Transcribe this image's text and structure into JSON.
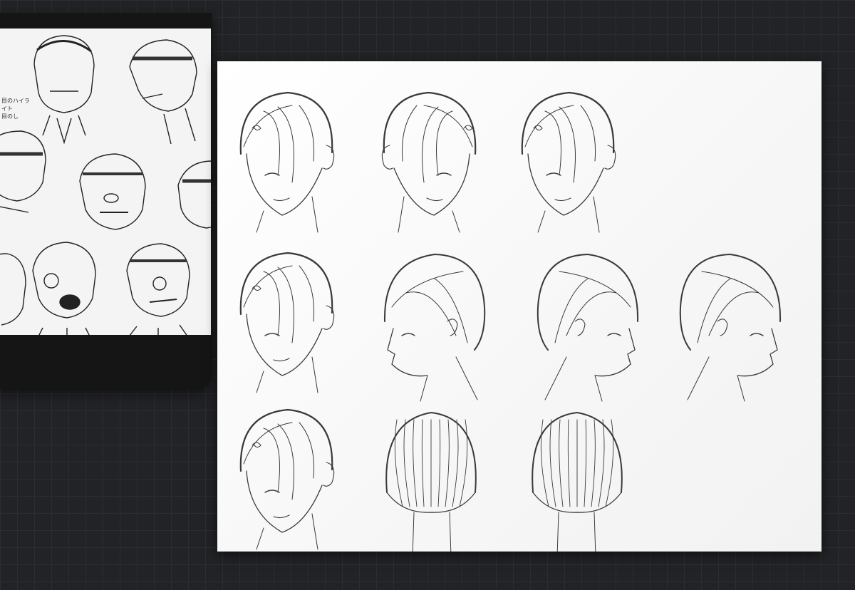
{
  "reference": {
    "note_lines": [
      "目のハイライト",
      "目のし"
    ]
  },
  "canvas": {
    "rows": [
      [
        "front-three-quarter",
        "front-tilted",
        "front-smile"
      ],
      [
        "front-grin",
        "profile-left",
        "profile-right",
        "three-quarter-right"
      ],
      [
        "three-quarter-down",
        "back",
        "back-three-quarter"
      ]
    ]
  },
  "colors": {
    "workspace_bg": "#222326",
    "grid_line": "#2c2d31",
    "panel_frame": "#151515",
    "sheet_bg": "#f4f4f4",
    "ink": "#3a3a3a"
  }
}
